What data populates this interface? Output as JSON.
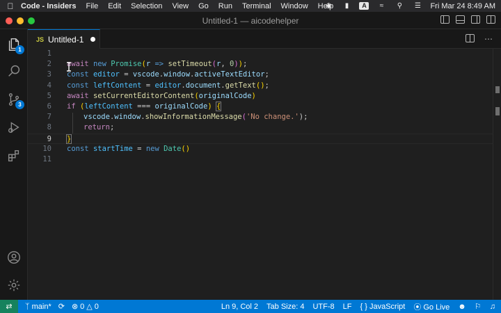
{
  "menubar": {
    "app_name": "Code - Insiders",
    "items": [
      "File",
      "Edit",
      "Selection",
      "View",
      "Go",
      "Run",
      "Terminal",
      "Window",
      "Help"
    ],
    "input_source": "A",
    "clock": "Fri Mar 24  8:49 AM"
  },
  "window": {
    "title": "Untitled-1 — aicodehelper"
  },
  "activity": {
    "explorer_badge": "1",
    "scm_badge": "3"
  },
  "tab": {
    "lang_label": "JS",
    "title": "Untitled-1"
  },
  "editor": {
    "active_line": 9,
    "lines": [
      {
        "n": "1"
      },
      {
        "n": "2"
      },
      {
        "n": "3"
      },
      {
        "n": "4"
      },
      {
        "n": "5"
      },
      {
        "n": "6"
      },
      {
        "n": "7"
      },
      {
        "n": "8"
      },
      {
        "n": "9"
      },
      {
        "n": "10"
      },
      {
        "n": "11"
      }
    ],
    "tokens": {
      "l2": [
        "await",
        " ",
        "new",
        " ",
        "Promise",
        "(",
        "r",
        " => ",
        "setTimeout",
        "(",
        "r",
        ", ",
        "0",
        ")",
        ")",
        ";"
      ],
      "l3": [
        "const",
        " ",
        "editor",
        " = ",
        "vscode",
        ".",
        "window",
        ".",
        "activeTextEditor",
        ";"
      ],
      "l4": [
        "const",
        " ",
        "leftContent",
        " = ",
        "editor",
        ".",
        "document",
        ".",
        "getText",
        "(",
        ")",
        ";"
      ],
      "l5": [
        "await",
        " ",
        "setCurrentEditorContent",
        "(",
        "originalCode",
        ")"
      ],
      "l6": [
        "if",
        " (",
        "leftContent",
        " === ",
        "originalCode",
        ") ",
        "{"
      ],
      "l7": [
        "vscode",
        ".",
        "window",
        ".",
        "showInformationMessage",
        "(",
        "'No change.'",
        ");"
      ],
      "l8": [
        "return",
        ";"
      ],
      "l9": [
        "}"
      ],
      "l10": [
        "const",
        " ",
        "startTime",
        " = ",
        "new",
        " ",
        "Date",
        "(",
        ")"
      ]
    }
  },
  "status": {
    "branch": "main*",
    "errors": "0",
    "warnings": "0",
    "position": "Ln 9, Col 2",
    "tab_size": "Tab Size: 4",
    "encoding": "UTF-8",
    "eol": "LF",
    "language": "JavaScript",
    "golive": "Go Live"
  },
  "colors": {
    "accent": "#0078d4",
    "remote": "#16825d",
    "keyword": "#569cd6",
    "control": "#c586c0",
    "function": "#dcdcaa",
    "string": "#ce9178",
    "number": "#b5cea8"
  }
}
